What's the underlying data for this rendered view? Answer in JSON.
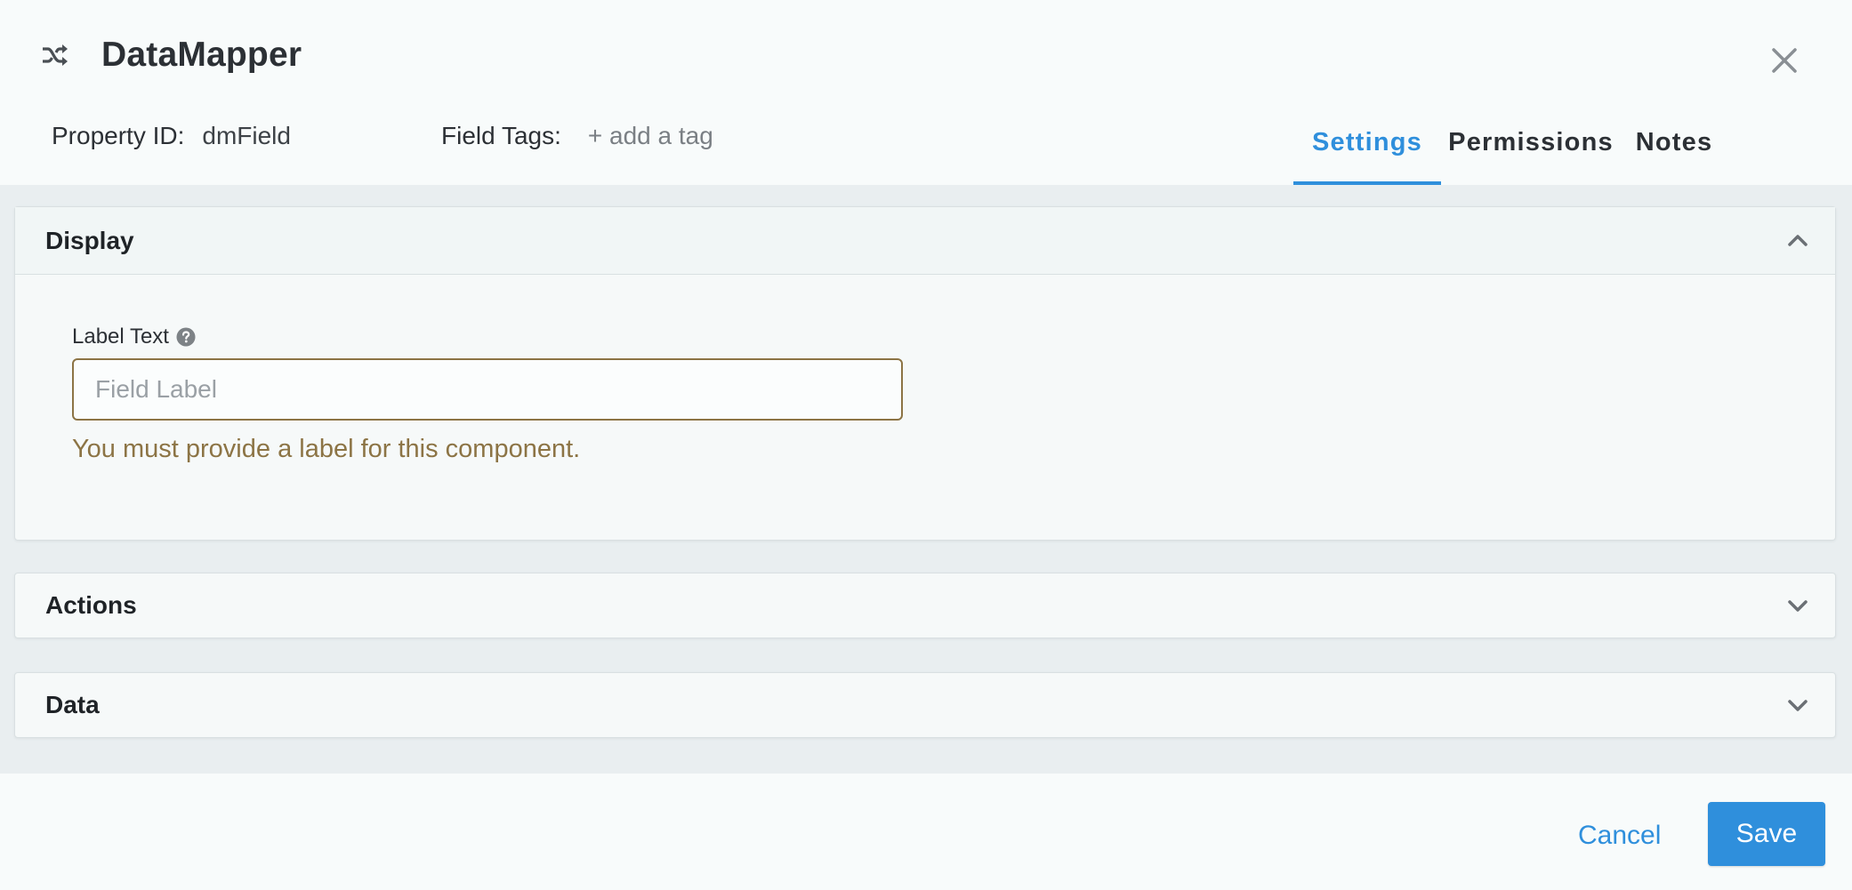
{
  "header": {
    "title": "DataMapper",
    "title_icon": "shuffle-icon",
    "close_icon": "close-icon",
    "property_id_label": "Property ID:",
    "property_id_value": "dmField",
    "field_tags_label": "Field Tags:",
    "add_tag_label": "+ add a tag"
  },
  "tabs": [
    {
      "label": "Settings",
      "active": true
    },
    {
      "label": "Permissions",
      "active": false
    },
    {
      "label": "Notes",
      "active": false
    }
  ],
  "sections": {
    "display": {
      "title": "Display",
      "expanded": true,
      "label_text": {
        "label": "Label Text",
        "placeholder": "Field Label",
        "value": "",
        "error": "You must provide a label for this component."
      }
    },
    "actions": {
      "title": "Actions",
      "expanded": false
    },
    "data": {
      "title": "Data",
      "expanded": false
    }
  },
  "footer": {
    "cancel_label": "Cancel",
    "save_label": "Save"
  },
  "colors": {
    "accent": "#2f8fdc",
    "error": "#8c7445"
  }
}
